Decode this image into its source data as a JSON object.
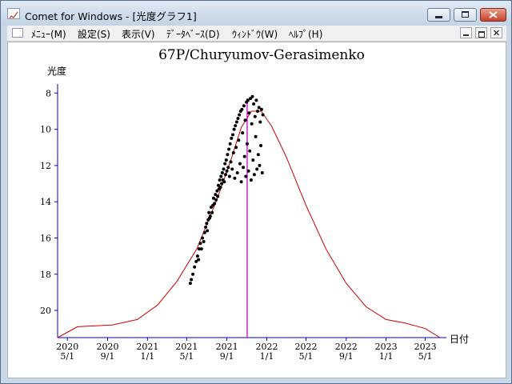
{
  "window": {
    "title": "Comet for Windows - [光度グラフ1]"
  },
  "menu": [
    "ﾒﾆｭｰ(M)",
    "設定(S)",
    "表示(V)",
    "ﾃﾞｰﾀﾍﾞｰｽ(D)",
    "ｳｨﾝﾄﾞｳ(W)",
    "ﾍﾙﾌﾟ(H)"
  ],
  "icons": {
    "app": "graph-icon",
    "minimize": "minimize-icon",
    "maximize": "maximize-icon",
    "close": "close-icon"
  },
  "colors": {
    "axis": "#0000cc",
    "curve": "#cc0000",
    "marker": "#cc00cc",
    "points": "#000000"
  },
  "chart_data": {
    "type": "scatter",
    "title": "67P/Churyumov-Gerasimenko",
    "ylabel": "光度",
    "xlabel": "日付",
    "y_inverted": true,
    "ylim": [
      21.5,
      7.5
    ],
    "yticks": [
      8,
      10,
      12,
      14,
      16,
      18,
      20
    ],
    "xlim": [
      "2020-04-01",
      "2023-06-15"
    ],
    "xticks": [
      {
        "date": "2020-05-01",
        "year": "2020",
        "md": "5/1"
      },
      {
        "date": "2020-09-01",
        "year": "2020",
        "md": "9/1"
      },
      {
        "date": "2021-01-01",
        "year": "2021",
        "md": "1/1"
      },
      {
        "date": "2021-05-01",
        "year": "2021",
        "md": "5/1"
      },
      {
        "date": "2021-09-01",
        "year": "2021",
        "md": "9/1"
      },
      {
        "date": "2022-01-01",
        "year": "2022",
        "md": "1/1"
      },
      {
        "date": "2022-05-01",
        "year": "2022",
        "md": "5/1"
      },
      {
        "date": "2022-09-01",
        "year": "2022",
        "md": "9/1"
      },
      {
        "date": "2023-01-01",
        "year": "2023",
        "md": "1/1"
      },
      {
        "date": "2023-05-01",
        "year": "2023",
        "md": "5/1"
      }
    ],
    "perihelion_date": "2021-11-02",
    "predicted_curve": [
      {
        "date": "2020-04-01",
        "mag": 21.5
      },
      {
        "date": "2020-06-01",
        "mag": 20.9
      },
      {
        "date": "2020-09-15",
        "mag": 20.8
      },
      {
        "date": "2020-12-01",
        "mag": 20.5
      },
      {
        "date": "2021-02-01",
        "mag": 19.7
      },
      {
        "date": "2021-04-01",
        "mag": 18.4
      },
      {
        "date": "2021-06-01",
        "mag": 16.6
      },
      {
        "date": "2021-08-01",
        "mag": 13.9
      },
      {
        "date": "2021-09-15",
        "mag": 11.6
      },
      {
        "date": "2021-10-15",
        "mag": 9.9
      },
      {
        "date": "2021-11-15",
        "mag": 9.0
      },
      {
        "date": "2021-12-15",
        "mag": 9.0
      },
      {
        "date": "2022-01-15",
        "mag": 9.8
      },
      {
        "date": "2022-03-01",
        "mag": 11.5
      },
      {
        "date": "2022-05-01",
        "mag": 14.2
      },
      {
        "date": "2022-07-01",
        "mag": 16.6
      },
      {
        "date": "2022-09-01",
        "mag": 18.5
      },
      {
        "date": "2022-11-01",
        "mag": 19.8
      },
      {
        "date": "2023-01-01",
        "mag": 20.5
      },
      {
        "date": "2023-03-01",
        "mag": 20.7
      },
      {
        "date": "2023-05-01",
        "mag": 21.0
      },
      {
        "date": "2023-06-15",
        "mag": 21.5
      }
    ],
    "observations": [
      [
        "2021-05-12",
        18.5
      ],
      [
        "2021-05-15",
        18.3
      ],
      [
        "2021-05-20",
        18.0
      ],
      [
        "2021-05-25",
        17.6
      ],
      [
        "2021-05-30",
        17.3
      ],
      [
        "2021-06-03",
        17.0
      ],
      [
        "2021-06-06",
        17.2
      ],
      [
        "2021-06-08",
        16.6
      ],
      [
        "2021-06-12",
        16.3
      ],
      [
        "2021-06-15",
        16.6
      ],
      [
        "2021-06-18",
        16.0
      ],
      [
        "2021-06-22",
        16.2
      ],
      [
        "2021-06-25",
        15.7
      ],
      [
        "2021-06-28",
        15.4
      ],
      [
        "2021-07-01",
        15.2
      ],
      [
        "2021-07-03",
        15.6
      ],
      [
        "2021-07-06",
        15.0
      ],
      [
        "2021-07-08",
        14.6
      ],
      [
        "2021-07-10",
        14.9
      ],
      [
        "2021-07-12",
        14.8
      ],
      [
        "2021-07-15",
        14.3
      ],
      [
        "2021-07-18",
        14.6
      ],
      [
        "2021-07-20",
        14.2
      ],
      [
        "2021-07-22",
        13.8
      ],
      [
        "2021-07-25",
        14.1
      ],
      [
        "2021-07-28",
        13.6
      ],
      [
        "2021-07-30",
        13.9
      ],
      [
        "2021-08-02",
        13.4
      ],
      [
        "2021-08-04",
        13.7
      ],
      [
        "2021-08-06",
        13.1
      ],
      [
        "2021-08-08",
        13.3
      ],
      [
        "2021-08-10",
        12.8
      ],
      [
        "2021-08-12",
        13.2
      ],
      [
        "2021-08-14",
        12.6
      ],
      [
        "2021-08-16",
        13.0
      ],
      [
        "2021-08-18",
        12.4
      ],
      [
        "2021-08-20",
        12.8
      ],
      [
        "2021-08-22",
        12.2
      ],
      [
        "2021-08-24",
        12.9
      ],
      [
        "2021-08-26",
        11.9
      ],
      [
        "2021-08-28",
        12.5
      ],
      [
        "2021-08-30",
        11.7
      ],
      [
        "2021-09-01",
        12.3
      ],
      [
        "2021-09-03",
        11.4
      ],
      [
        "2021-09-05",
        12.1
      ],
      [
        "2021-09-07",
        11.1
      ],
      [
        "2021-09-09",
        12.6
      ],
      [
        "2021-09-11",
        10.8
      ],
      [
        "2021-09-13",
        11.8
      ],
      [
        "2021-09-15",
        10.5
      ],
      [
        "2021-09-17",
        12.2
      ],
      [
        "2021-09-19",
        10.3
      ],
      [
        "2021-09-21",
        11.3
      ],
      [
        "2021-09-23",
        10.0
      ],
      [
        "2021-09-25",
        12.7
      ],
      [
        "2021-09-27",
        9.8
      ],
      [
        "2021-09-29",
        11.0
      ],
      [
        "2021-10-01",
        9.6
      ],
      [
        "2021-10-03",
        12.4
      ],
      [
        "2021-10-05",
        9.4
      ],
      [
        "2021-10-07",
        10.6
      ],
      [
        "2021-10-09",
        9.2
      ],
      [
        "2021-10-11",
        11.9
      ],
      [
        "2021-10-13",
        9.0
      ],
      [
        "2021-10-15",
        12.9
      ],
      [
        "2021-10-17",
        8.9
      ],
      [
        "2021-10-19",
        10.2
      ],
      [
        "2021-10-21",
        12.1
      ],
      [
        "2021-10-23",
        8.7
      ],
      [
        "2021-10-25",
        11.5
      ],
      [
        "2021-10-27",
        9.5
      ],
      [
        "2021-10-29",
        12.6
      ],
      [
        "2021-10-31",
        8.5
      ],
      [
        "2021-11-02",
        10.8
      ],
      [
        "2021-11-04",
        8.4
      ],
      [
        "2021-11-06",
        12.3
      ],
      [
        "2021-11-08",
        9.1
      ],
      [
        "2021-11-10",
        11.2
      ],
      [
        "2021-11-12",
        8.3
      ],
      [
        "2021-11-14",
        12.8
      ],
      [
        "2021-11-16",
        9.7
      ],
      [
        "2021-11-18",
        8.2
      ],
      [
        "2021-11-20",
        11.7
      ],
      [
        "2021-11-22",
        8.6
      ],
      [
        "2021-11-24",
        12.5
      ],
      [
        "2021-11-26",
        9.3
      ],
      [
        "2021-11-28",
        10.4
      ],
      [
        "2021-11-30",
        8.4
      ],
      [
        "2021-12-02",
        12.2
      ],
      [
        "2021-12-04",
        9.0
      ],
      [
        "2021-12-06",
        11.4
      ],
      [
        "2021-12-08",
        8.8
      ],
      [
        "2021-12-10",
        12.0
      ],
      [
        "2021-12-12",
        9.6
      ],
      [
        "2021-12-14",
        10.9
      ],
      [
        "2021-12-16",
        8.9
      ],
      [
        "2021-12-18",
        12.4
      ],
      [
        "2021-12-20",
        9.2
      ]
    ]
  }
}
